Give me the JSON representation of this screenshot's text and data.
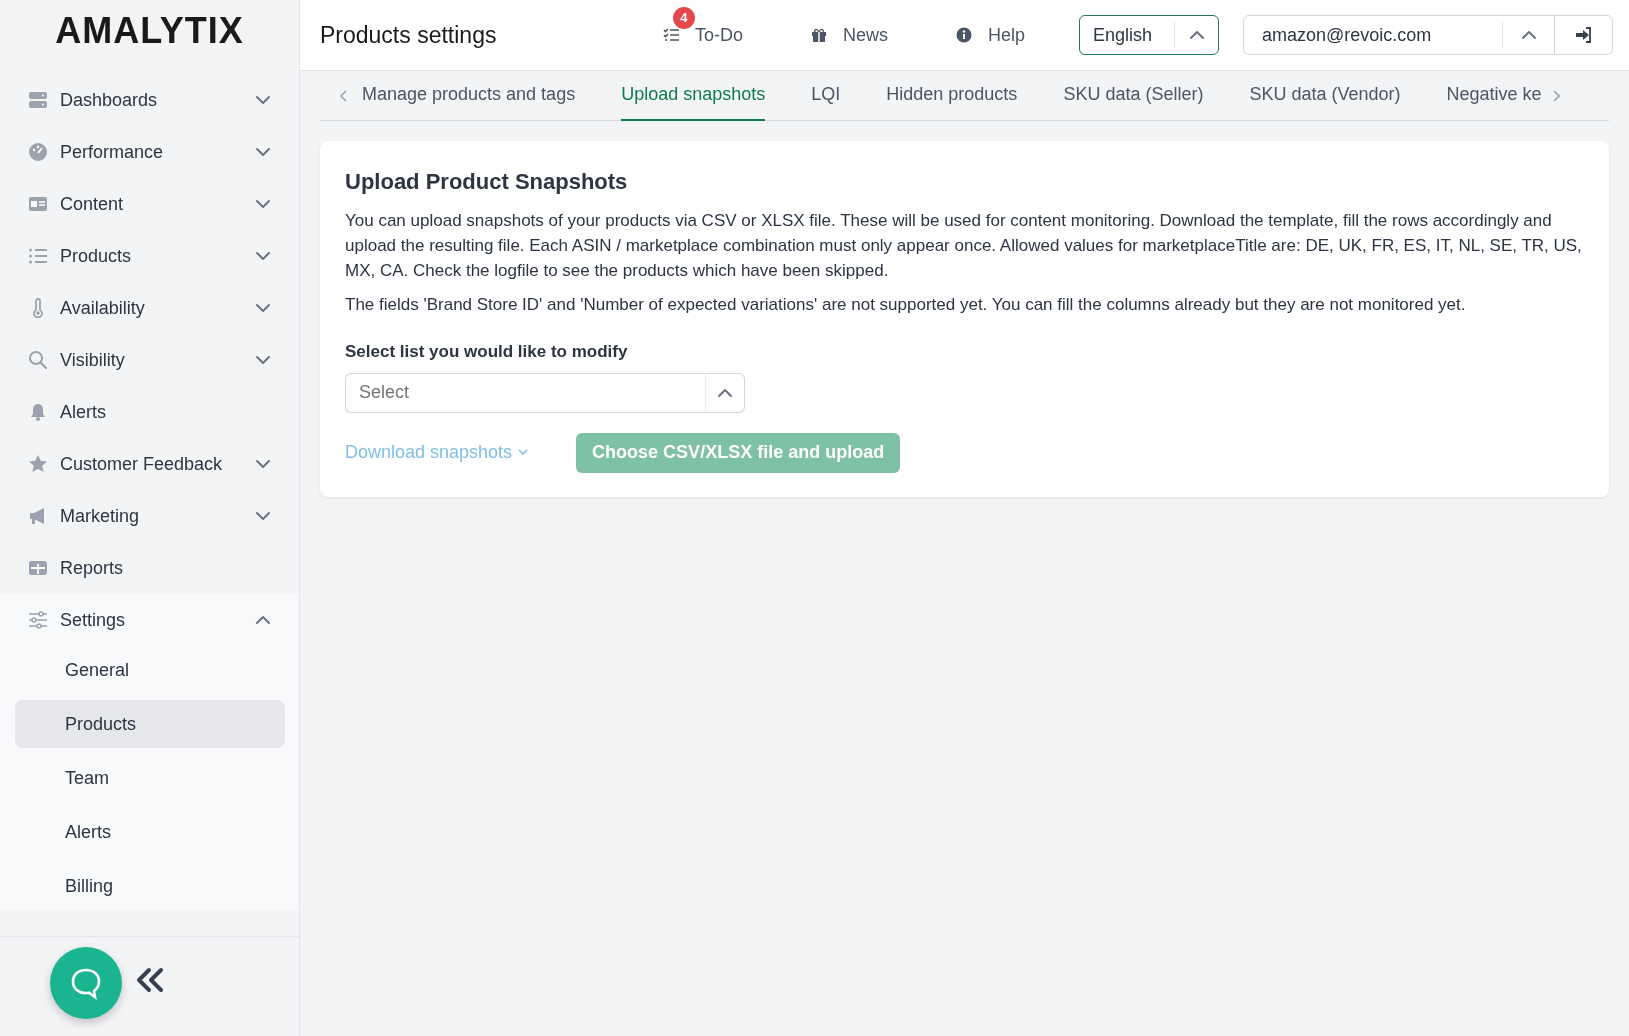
{
  "logo": "AMALYTIX",
  "sidebar": {
    "items": [
      {
        "label": "Dashboards",
        "expanded": false
      },
      {
        "label": "Performance",
        "expanded": false
      },
      {
        "label": "Content",
        "expanded": false
      },
      {
        "label": "Products",
        "expanded": false
      },
      {
        "label": "Availability",
        "expanded": false
      },
      {
        "label": "Visibility",
        "expanded": false
      },
      {
        "label": "Alerts"
      },
      {
        "label": "Customer Feedback",
        "expanded": false
      },
      {
        "label": "Marketing",
        "expanded": false
      },
      {
        "label": "Reports"
      },
      {
        "label": "Settings",
        "expanded": true,
        "children": [
          {
            "label": "General",
            "selected": false
          },
          {
            "label": "Products",
            "selected": true
          },
          {
            "label": "Team",
            "selected": false
          },
          {
            "label": "Alerts",
            "selected": false
          },
          {
            "label": "Billing",
            "selected": false
          }
        ]
      }
    ]
  },
  "header": {
    "title": "Products settings",
    "todo": {
      "label": "To-Do",
      "badge": "4"
    },
    "news": "News",
    "help": "Help",
    "language": "English",
    "account": "amazon@revoic.com"
  },
  "tabs": [
    {
      "label": "Manage products and tags",
      "selected": false
    },
    {
      "label": "Upload snapshots",
      "selected": true
    },
    {
      "label": "LQI",
      "selected": false
    },
    {
      "label": "Hidden products",
      "selected": false
    },
    {
      "label": "SKU data (Seller)",
      "selected": false
    },
    {
      "label": "SKU data (Vendor)",
      "selected": false
    },
    {
      "label": "Negative ke",
      "selected": false
    }
  ],
  "card": {
    "title": "Upload Product Snapshots",
    "paragraphs": [
      "You can upload snapshots of your products via CSV or XLSX file. These will be used for content monitoring. Download the template, fill the rows accordingly and upload the resulting file. Each ASIN / marketplace combination must only appear once. Allowed values for marketplaceTitle are: DE, UK, FR, ES, IT, NL, SE, TR, US, MX, CA. Check the logfile to see the products which have been skipped.",
      "The fields 'Brand Store ID' and 'Number of expected variations' are not supported yet. You can fill the columns already but they are not monitored yet."
    ],
    "select_label": "Select list you would like to modify",
    "select": {
      "placeholder": "Select"
    },
    "download": {
      "label": "Download snapshots",
      "disabled": true
    },
    "upload": {
      "label": "Choose CSV/XLSX file and upload",
      "disabled": true
    }
  }
}
